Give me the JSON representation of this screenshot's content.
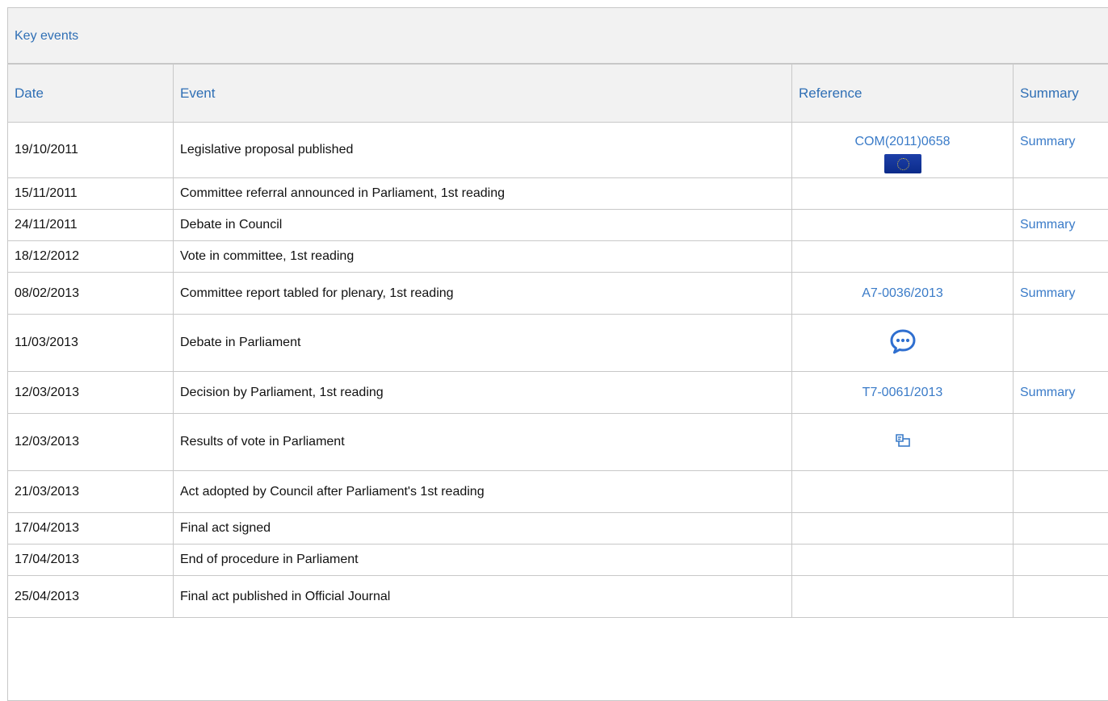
{
  "panel": {
    "title": "Key events"
  },
  "columns": {
    "date": "Date",
    "event": "Event",
    "reference": "Reference",
    "summary": "Summary"
  },
  "rows": [
    {
      "date": "19/10/2011",
      "event": "Legislative proposal published",
      "reference": "COM(2011)0658",
      "ref_icon": "eu-flag-icon",
      "summary": "Summary"
    },
    {
      "date": "15/11/2011",
      "event": "Committee referral announced in Parliament, 1st reading",
      "reference": "",
      "summary": ""
    },
    {
      "date": "24/11/2011",
      "event": "Debate in Council",
      "reference": "",
      "summary": "Summary"
    },
    {
      "date": "18/12/2012",
      "event": "Vote in committee, 1st reading",
      "reference": "",
      "summary": ""
    },
    {
      "date": "08/02/2013",
      "event": "Committee report tabled for plenary, 1st reading",
      "reference": "A7-0036/2013",
      "summary": "Summary"
    },
    {
      "date": "11/03/2013",
      "event": "Debate in Parliament",
      "reference": "",
      "ref_icon": "speech-bubble-icon",
      "summary": ""
    },
    {
      "date": "12/03/2013",
      "event": "Decision by Parliament, 1st reading",
      "reference": "T7-0061/2013",
      "summary": "Summary"
    },
    {
      "date": "12/03/2013",
      "event": "Results of vote in Parliament",
      "reference": "",
      "ref_icon": "vote-results-icon",
      "summary": ""
    },
    {
      "date": "21/03/2013",
      "event": "Act adopted by Council after Parliament's 1st reading",
      "reference": "",
      "summary": ""
    },
    {
      "date": "17/04/2013",
      "event": "Final act signed",
      "reference": "",
      "summary": ""
    },
    {
      "date": "17/04/2013",
      "event": "End of procedure in Parliament",
      "reference": "",
      "summary": ""
    },
    {
      "date": "25/04/2013",
      "event": "Final act published in Official Journal",
      "reference": "",
      "summary": ""
    }
  ],
  "colors": {
    "link": "#3a7bc8",
    "header_bg": "#f2f2f2",
    "border": "#c8c8c8"
  }
}
